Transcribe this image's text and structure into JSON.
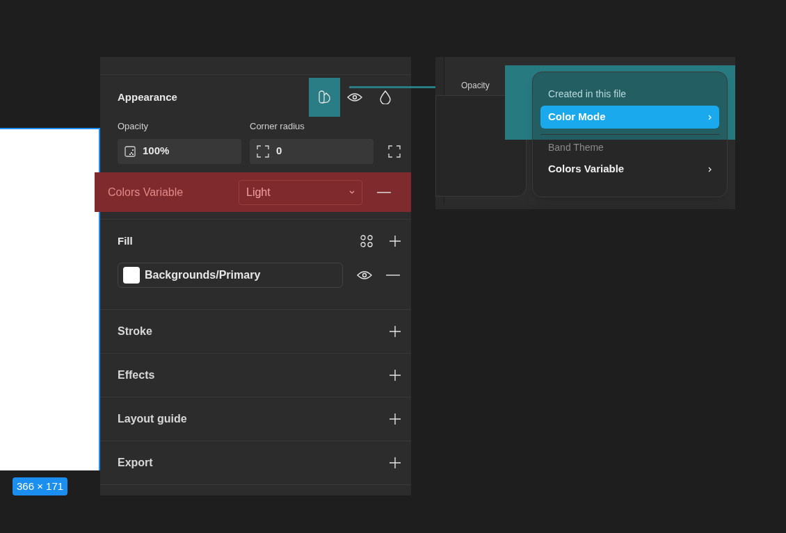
{
  "canvas": {
    "size_badge": "366 × 171"
  },
  "appearance": {
    "title": "Appearance",
    "mode_button_highlighted": true,
    "opacity": {
      "label": "Opacity",
      "value": "100%"
    },
    "corner_radius": {
      "label": "Corner radius",
      "value": "0"
    },
    "variable_row": {
      "label": "Colors Variable",
      "value": "Light",
      "highlighted": true
    }
  },
  "fill": {
    "title": "Fill",
    "items": [
      {
        "name": "Backgrounds/Primary",
        "color": "#ffffff"
      }
    ]
  },
  "sections": [
    {
      "title": "Stroke"
    },
    {
      "title": "Effects"
    },
    {
      "title": "Layout guide"
    },
    {
      "title": "Export"
    }
  ],
  "inset": {
    "label": "Opacity",
    "highlighted": true,
    "menu": [
      {
        "kind": "header",
        "label": "Created in this file"
      },
      {
        "kind": "item",
        "label": "Color Mode",
        "selected": true
      },
      {
        "kind": "header",
        "label": "Band Theme"
      },
      {
        "kind": "item",
        "label": "Colors Variable",
        "selected": false
      }
    ]
  }
}
